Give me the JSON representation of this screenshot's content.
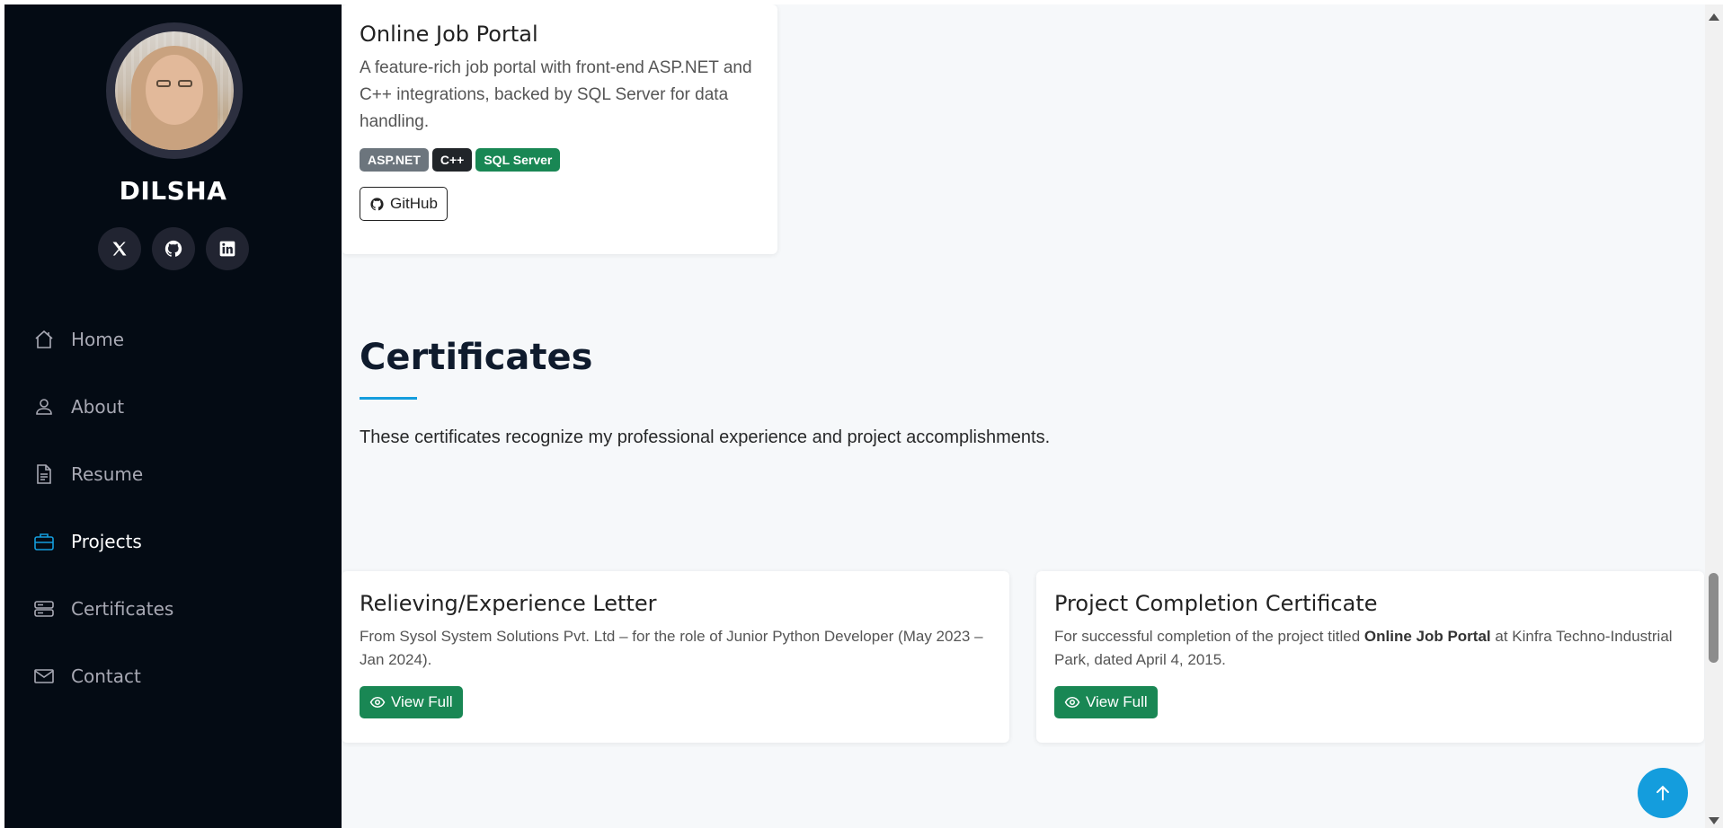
{
  "profile": {
    "name": "DILSHA",
    "socials": [
      {
        "icon": "x-twitter-icon",
        "label": "X"
      },
      {
        "icon": "github-icon",
        "label": "GitHub"
      },
      {
        "icon": "linkedin-icon",
        "label": "LinkedIn"
      }
    ]
  },
  "nav": {
    "items": [
      {
        "label": "Home",
        "icon": "house-icon"
      },
      {
        "label": "About",
        "icon": "person-icon"
      },
      {
        "label": "Resume",
        "icon": "file-text-icon"
      },
      {
        "label": "Projects",
        "icon": "briefcase-icon",
        "active": true
      },
      {
        "label": "Certificates",
        "icon": "server-icon"
      },
      {
        "label": "Contact",
        "icon": "envelope-icon"
      }
    ]
  },
  "project": {
    "title": "Online Job Portal",
    "description": "A feature-rich job portal with front-end ASP.NET and C++ integrations, backed by SQL Server for data handling.",
    "badges": [
      {
        "label": "ASP.NET",
        "color": "#6c757d"
      },
      {
        "label": "C++",
        "color": "#212529"
      },
      {
        "label": "SQL Server",
        "color": "#198754"
      }
    ],
    "github_label": "GitHub"
  },
  "certificates": {
    "title": "Certificates",
    "description": "These certificates recognize my professional experience and project accomplishments.",
    "cards": [
      {
        "title": "Relieving/Experience Letter",
        "text": "From Sysol System Solutions Pvt. Ltd – for the role of Junior Python Developer (May 2023 – Jan 2024).",
        "button": "View Full"
      },
      {
        "title": "Project Completion Certificate",
        "text_before": "For successful completion of the project titled ",
        "text_bold": "Online Job Portal",
        "text_after": " at Kinfra Techno-Industrial Park, dated April 4, 2015.",
        "button": "View Full"
      }
    ]
  },
  "colors": {
    "sidebar_bg": "#040b14",
    "accent": "#149ddd",
    "success": "#198754"
  }
}
